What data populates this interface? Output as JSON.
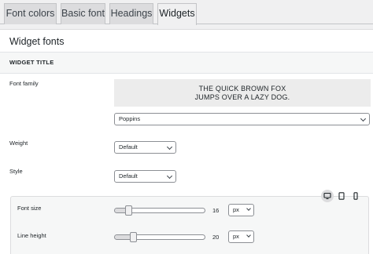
{
  "tabs": [
    {
      "label": "Font colors",
      "active": false
    },
    {
      "label": "Basic font",
      "active": false
    },
    {
      "label": "Headings",
      "active": false
    },
    {
      "label": "Widgets",
      "active": true
    }
  ],
  "panel": {
    "title": "Widget fonts",
    "section_title": "WIDGET TITLE"
  },
  "fields": {
    "font_family": {
      "label": "Font family",
      "preview_line1": "THE QUICK BROWN FOX",
      "preview_line2": "JUMPS OVER A LAZY DOG.",
      "value": "Poppins"
    },
    "weight": {
      "label": "Weight",
      "value": "Default"
    },
    "style": {
      "label": "Style",
      "value": "Default"
    }
  },
  "responsive": {
    "devices": [
      {
        "icon": "desktop-icon",
        "active": true
      },
      {
        "icon": "tablet-icon",
        "active": false
      },
      {
        "icon": "mobile-icon",
        "active": false
      }
    ],
    "font_size": {
      "label": "Font size",
      "value": "16",
      "unit": "px",
      "slider_fraction": 0.12
    },
    "line_height": {
      "label": "Line height",
      "value": "20",
      "unit": "px",
      "slider_fraction": 0.18
    }
  },
  "colors": {
    "border": "#c3c4c7",
    "active_tab_bg": "#f0f0f1",
    "inactive_tab_bg": "#dcdcde",
    "panel_bg": "#ffffff",
    "preview_bg": "#ececec"
  }
}
